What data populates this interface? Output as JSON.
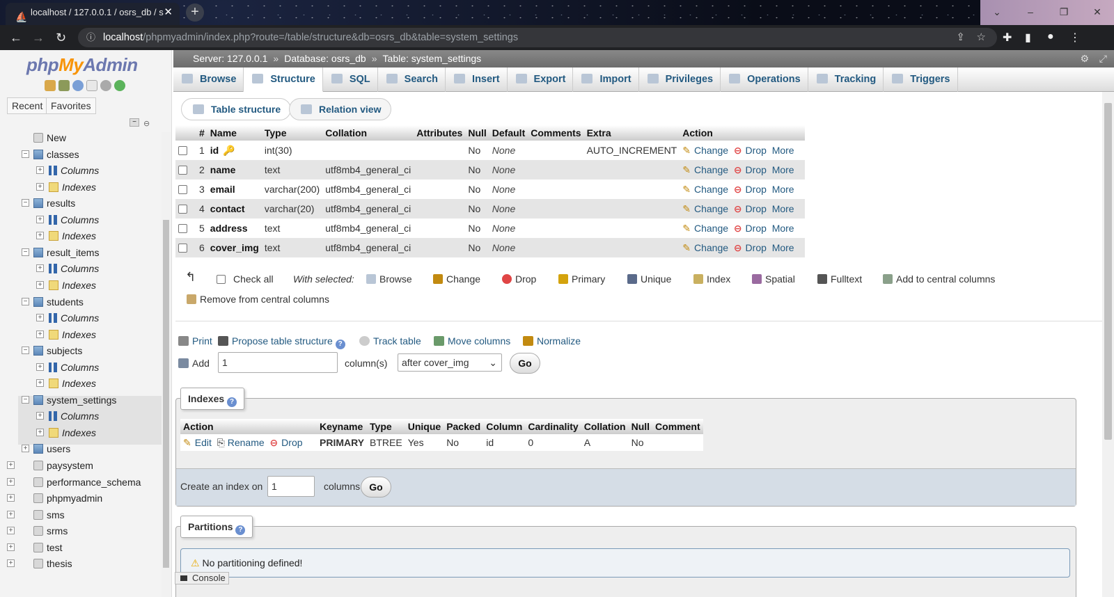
{
  "browser": {
    "tab_title": "localhost / 127.0.0.1 / osrs_db / s",
    "url_host": "localhost",
    "url_path": "/phpmyadmin/index.php?route=/table/structure&db=osrs_db&table=system_settings"
  },
  "sidebar": {
    "logo_php": "php",
    "logo_my": "My",
    "logo_admin": "Admin",
    "tabs": [
      "Recent",
      "Favorites"
    ],
    "tree": [
      {
        "label": "New",
        "kind": "new"
      },
      {
        "label": "classes",
        "kind": "table"
      },
      {
        "label": "Columns",
        "kind": "columns"
      },
      {
        "label": "Indexes",
        "kind": "indexes"
      },
      {
        "label": "results",
        "kind": "table"
      },
      {
        "label": "Columns",
        "kind": "columns"
      },
      {
        "label": "Indexes",
        "kind": "indexes"
      },
      {
        "label": "result_items",
        "kind": "table"
      },
      {
        "label": "Columns",
        "kind": "columns"
      },
      {
        "label": "Indexes",
        "kind": "indexes"
      },
      {
        "label": "students",
        "kind": "table"
      },
      {
        "label": "Columns",
        "kind": "columns"
      },
      {
        "label": "Indexes",
        "kind": "indexes"
      },
      {
        "label": "subjects",
        "kind": "table"
      },
      {
        "label": "Columns",
        "kind": "columns"
      },
      {
        "label": "Indexes",
        "kind": "indexes"
      },
      {
        "label": "system_settings",
        "kind": "table"
      },
      {
        "label": "Columns",
        "kind": "columns"
      },
      {
        "label": "Indexes",
        "kind": "indexes"
      },
      {
        "label": "users",
        "kind": "table"
      },
      {
        "label": "paysystem",
        "kind": "db"
      },
      {
        "label": "performance_schema",
        "kind": "db"
      },
      {
        "label": "phpmyadmin",
        "kind": "db"
      },
      {
        "label": "sms",
        "kind": "db"
      },
      {
        "label": "srms",
        "kind": "db"
      },
      {
        "label": "test",
        "kind": "db"
      },
      {
        "label": "thesis",
        "kind": "db"
      }
    ]
  },
  "breadcrumb": {
    "server": "Server: 127.0.0.1",
    "database": "Database: osrs_db",
    "table": "Table: system_settings",
    "sep": "»"
  },
  "topmenu": [
    "Browse",
    "Structure",
    "SQL",
    "Search",
    "Insert",
    "Export",
    "Import",
    "Privileges",
    "Operations",
    "Tracking",
    "Triggers"
  ],
  "subtabs": [
    "Table structure",
    "Relation view"
  ],
  "structure": {
    "headers": [
      "#",
      "Name",
      "Type",
      "Collation",
      "Attributes",
      "Null",
      "Default",
      "Comments",
      "Extra",
      "Action"
    ],
    "rows": [
      {
        "num": "1",
        "name": "id",
        "type": "int(30)",
        "collation": "",
        "attributes": "",
        "null": "No",
        "default": "None",
        "comments": "",
        "extra": "AUTO_INCREMENT"
      },
      {
        "num": "2",
        "name": "name",
        "type": "text",
        "collation": "utf8mb4_general_ci",
        "attributes": "",
        "null": "No",
        "default": "None",
        "comments": "",
        "extra": ""
      },
      {
        "num": "3",
        "name": "email",
        "type": "varchar(200)",
        "collation": "utf8mb4_general_ci",
        "attributes": "",
        "null": "No",
        "default": "None",
        "comments": "",
        "extra": ""
      },
      {
        "num": "4",
        "name": "contact",
        "type": "varchar(20)",
        "collation": "utf8mb4_general_ci",
        "attributes": "",
        "null": "No",
        "default": "None",
        "comments": "",
        "extra": ""
      },
      {
        "num": "5",
        "name": "address",
        "type": "text",
        "collation": "utf8mb4_general_ci",
        "attributes": "",
        "null": "No",
        "default": "None",
        "comments": "",
        "extra": ""
      },
      {
        "num": "6",
        "name": "cover_img",
        "type": "text",
        "collation": "utf8mb4_general_ci",
        "attributes": "",
        "null": "No",
        "default": "None",
        "comments": "",
        "extra": ""
      }
    ],
    "action_change": "Change",
    "action_drop": "Drop",
    "action_more": "More"
  },
  "bulk": {
    "check_all": "Check all",
    "with_selected": "With selected:",
    "actions": [
      "Browse",
      "Change",
      "Drop",
      "Primary",
      "Unique",
      "Index",
      "Spatial",
      "Fulltext",
      "Add to central columns"
    ],
    "remove_central": "Remove from central columns"
  },
  "tools": {
    "print": "Print",
    "propose": "Propose table structure",
    "track": "Track table",
    "move": "Move columns",
    "normalize": "Normalize"
  },
  "add_column": {
    "label": "Add",
    "count": "1",
    "suffix": "column(s)",
    "position": "after cover_img",
    "go": "Go"
  },
  "indexes": {
    "legend": "Indexes",
    "headers": [
      "Action",
      "Keyname",
      "Type",
      "Unique",
      "Packed",
      "Column",
      "Cardinality",
      "Collation",
      "Null",
      "Comment"
    ],
    "row": {
      "edit": "Edit",
      "rename": "Rename",
      "drop": "Drop",
      "keyname": "PRIMARY",
      "type": "BTREE",
      "unique": "Yes",
      "packed": "No",
      "column": "id",
      "cardinality": "0",
      "collation": "A",
      "null": "No",
      "comment": ""
    },
    "create_label": "Create an index on",
    "create_count": "1",
    "create_suffix": "columns",
    "go": "Go"
  },
  "partitions": {
    "legend": "Partitions",
    "message": "No partitioning defined!"
  },
  "console": "Console"
}
